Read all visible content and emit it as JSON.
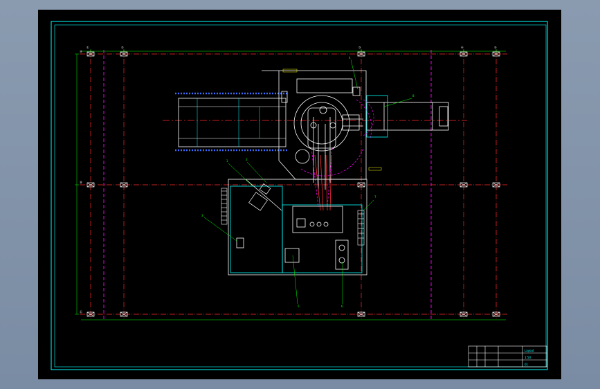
{
  "colors": {
    "frame": "#00ffff",
    "grid_axis": "#ff0000",
    "aux_axis": "#ff00ff",
    "equipment": "#ffffff",
    "dimension": "#00ff00",
    "conveyor": "#3b6bff",
    "tag": "#ffff00"
  },
  "grid": {
    "column_labels_top": [
      "①",
      "②",
      "③",
      "④",
      "⑤"
    ],
    "row_labels_left": [
      "Ⓐ",
      "Ⓑ",
      "Ⓒ"
    ]
  },
  "title_block": {
    "drawing_name": "Layout",
    "scale": "1:50",
    "sheet": "01"
  },
  "callouts": [
    "1",
    "2",
    "3",
    "4",
    "5",
    "6",
    "7",
    "8"
  ]
}
